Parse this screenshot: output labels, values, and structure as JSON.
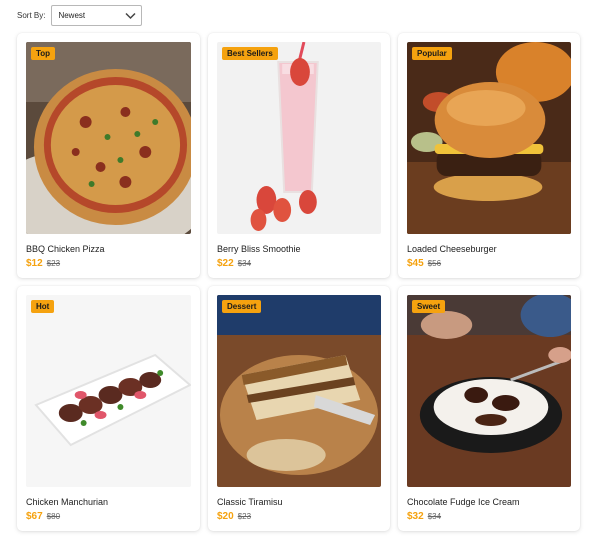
{
  "sort": {
    "label": "Sort By:",
    "selected": "Newest"
  },
  "items": [
    {
      "badge": "Top",
      "name": "BBQ Chicken Pizza",
      "price": "$12",
      "old_price": "$23"
    },
    {
      "badge": "Best Sellers",
      "name": "Berry Bliss Smoothie",
      "price": "$22",
      "old_price": "$34"
    },
    {
      "badge": "Popular",
      "name": "Loaded Cheeseburger",
      "price": "$45",
      "old_price": "$56"
    },
    {
      "badge": "Hot",
      "name": "Chicken Manchurian",
      "price": "$67",
      "old_price": "$80"
    },
    {
      "badge": "Dessert",
      "name": "Classic Tiramisu",
      "price": "$20",
      "old_price": "$23"
    },
    {
      "badge": "Sweet",
      "name": "Chocolate Fudge Ice Cream",
      "price": "$32",
      "old_price": "$34"
    }
  ],
  "colors": {
    "accent": "#f5a20f"
  },
  "icons": {
    "sort_dropdown": "chevron-down-icon"
  }
}
